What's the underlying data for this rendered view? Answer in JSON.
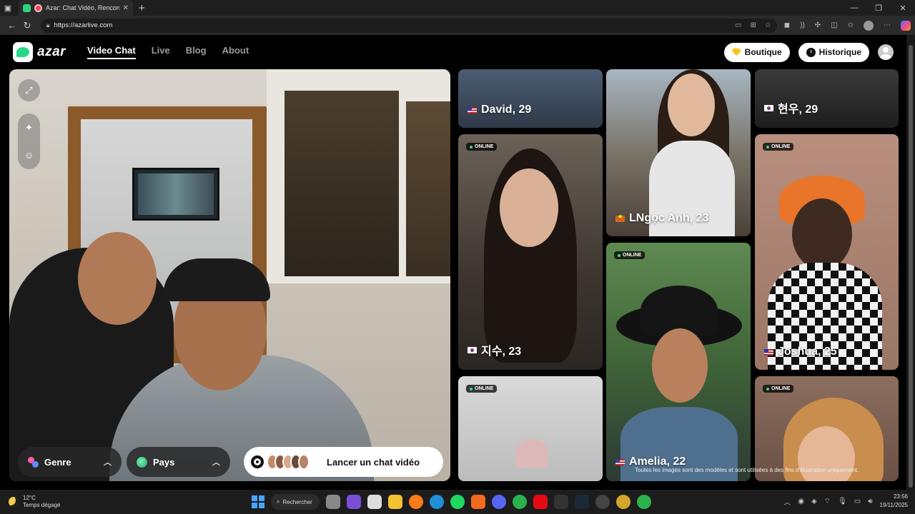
{
  "browser": {
    "tab_title": "Azar: Chat Vidéo, Rencontre",
    "url": "https://azarlive.com"
  },
  "header": {
    "logo_text": "azar",
    "nav": [
      {
        "label": "Video Chat",
        "active": true
      },
      {
        "label": "Live",
        "active": false
      },
      {
        "label": "Blog",
        "active": false
      },
      {
        "label": "About",
        "active": false
      }
    ],
    "boutique_label": "Boutique",
    "historique_label": "Historique"
  },
  "controls": {
    "genre_label": "Genre",
    "pays_label": "Pays",
    "launch_label": "Lancer un chat vidéo"
  },
  "profiles": [
    {
      "name": "David, 29",
      "flag": "us",
      "online": false
    },
    {
      "name": "현우, 29",
      "flag": "kr",
      "online": false
    },
    {
      "name": "LNgọc Anh, 23",
      "flag": "vn",
      "online": false
    },
    {
      "name": "지수, 23",
      "flag": "kr",
      "online": true
    },
    {
      "name": "Joshua, 25",
      "flag": "us",
      "online": true
    },
    {
      "name": "Amelia, 22",
      "flag": "us",
      "online": true
    },
    {
      "name": "",
      "online": true
    },
    {
      "name": "",
      "online": true
    }
  ],
  "online_label": "ONLINE",
  "disclaimer": "Toutes les images sont des modèles et sont utilisées à des fins d'illustration uniquement.",
  "taskbar": {
    "temperature": "12°C",
    "weather": "Temps dégagé",
    "search_label": "Rechercher",
    "time": "23:56",
    "date": "19/11/2025"
  },
  "colors": {
    "accent_green": "#25d985",
    "online_dot": "#2fe08a"
  }
}
